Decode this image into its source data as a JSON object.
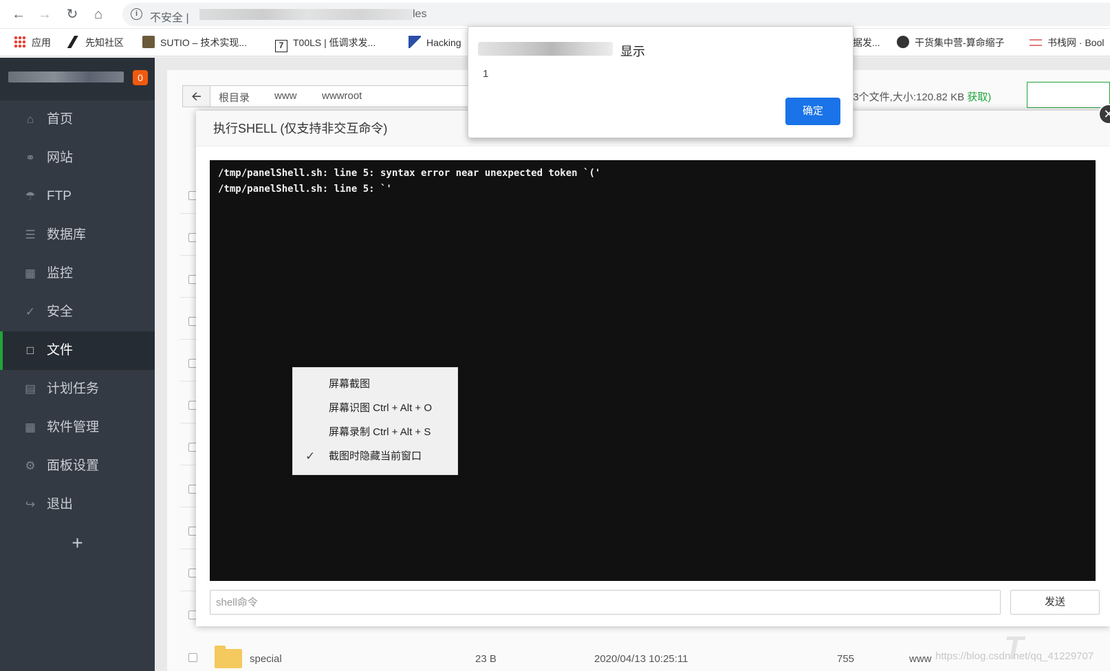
{
  "browser": {
    "address_security": "不安全",
    "address_separator": "|",
    "address_tail": "les",
    "bookmarks": [
      {
        "label": "应用",
        "icon": "apps-grid-icon"
      },
      {
        "label": "先知社区",
        "icon": "xianzhi-icon"
      },
      {
        "label": "SUTIO – 技术实现...",
        "icon": "sutio-icon"
      },
      {
        "label": "T00LS | 低调求发...",
        "icon": "tools-icon"
      },
      {
        "label": "Hacking",
        "icon": "hacking-icon"
      },
      {
        "label": "据发...",
        "icon": ""
      },
      {
        "label": "干货集中营-算命缩子",
        "icon": "avatar-icon"
      },
      {
        "label": "书栈网 · Bool",
        "icon": "book-icon"
      }
    ]
  },
  "sidebar": {
    "badge": "0",
    "items": [
      {
        "label": "首页",
        "icon": "home-icon"
      },
      {
        "label": "网站",
        "icon": "globe-icon"
      },
      {
        "label": "FTP",
        "icon": "ftp-icon"
      },
      {
        "label": "数据库",
        "icon": "database-icon"
      },
      {
        "label": "监控",
        "icon": "monitor-icon"
      },
      {
        "label": "安全",
        "icon": "shield-icon"
      },
      {
        "label": "文件",
        "icon": "folder-icon"
      },
      {
        "label": "计划任务",
        "icon": "calendar-icon"
      },
      {
        "label": "软件管理",
        "icon": "apps-icon"
      },
      {
        "label": "面板设置",
        "icon": "gear-icon"
      },
      {
        "label": "退出",
        "icon": "logout-icon"
      }
    ],
    "active_index": 6,
    "add_label": "+"
  },
  "files": {
    "breadcrumb": [
      "根目录",
      "www",
      "wwwroot"
    ],
    "stat_text": "13个文件,大小:120.82 KB ",
    "stat_link": "获取)",
    "last_row": {
      "name": "special",
      "size": "23 B",
      "mtime": "2020/04/13 10:25:11",
      "perm": "755",
      "owner": "www"
    }
  },
  "shell": {
    "title": "执行SHELL (仅支持非交互命令)",
    "output_lines": [
      "/tmp/panelShell.sh: line 5: syntax error near unexpected token `('",
      "/tmp/panelShell.sh: line 5: `'"
    ],
    "input_placeholder": "shell命令",
    "send_label": "发送"
  },
  "context_menu": {
    "items": [
      {
        "label": "屏幕截图",
        "checked": false
      },
      {
        "label": "屏幕识图 Ctrl + Alt + O",
        "checked": false
      },
      {
        "label": "屏幕录制 Ctrl + Alt + S",
        "checked": false
      },
      {
        "label": "截图时隐藏当前窗口",
        "checked": true
      }
    ]
  },
  "alert": {
    "title_suffix": "显示",
    "message": "1",
    "ok_label": "确定"
  },
  "watermark": "https://blog.csdn.net/qq_41229707"
}
